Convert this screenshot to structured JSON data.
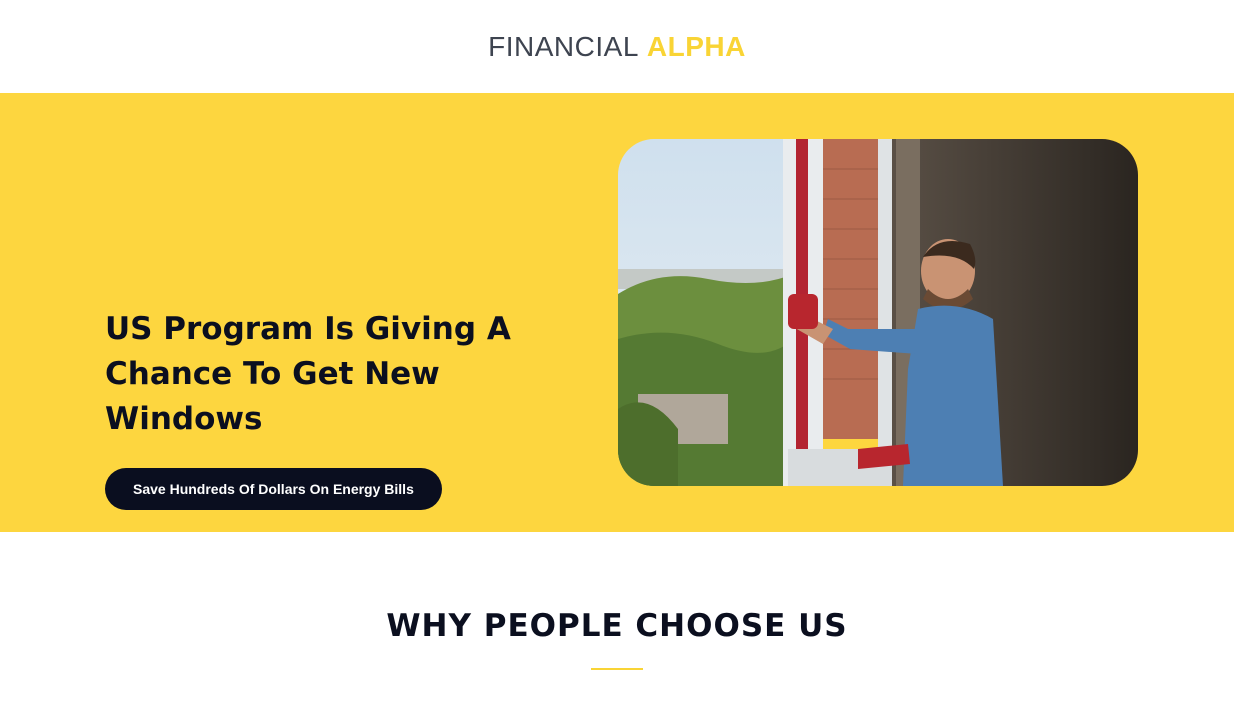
{
  "header": {
    "logo_light": "FINANCIAL",
    "logo_bold": "ALPHA"
  },
  "hero": {
    "title": "US Program Is Giving A Chance To Get New Windows",
    "cta_label": "Save Hundreds Of Dollars On Energy Bills",
    "image_alt": "man-installing-window-photo"
  },
  "why": {
    "title": "WHY PEOPLE CHOOSE US"
  },
  "colors": {
    "accent": "#f9d435",
    "hero_bg": "#fdd63f",
    "dark": "#0a0e1f"
  }
}
